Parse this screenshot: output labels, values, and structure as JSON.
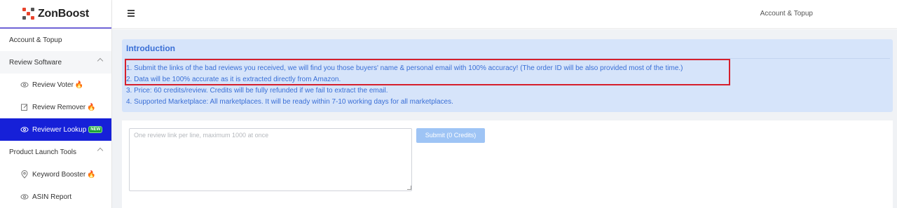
{
  "brand": {
    "name_prefix": "Zon",
    "name_suffix": "Boost",
    "logo_colors": [
      "#e8432c",
      "#555555"
    ]
  },
  "header": {
    "menu_icon": "hamburger-icon",
    "account_link": "Account & Topup"
  },
  "sidebar": {
    "items": [
      {
        "label": "Account & Topup",
        "type": "top"
      },
      {
        "label": "Review Software",
        "type": "group"
      },
      {
        "label": "Review Voter",
        "type": "sub",
        "icon": "eye-icon",
        "hot": true
      },
      {
        "label": "Review Remover",
        "type": "sub",
        "icon": "edit-icon",
        "hot": true
      },
      {
        "label": "Reviewer Lookup",
        "type": "sub",
        "icon": "eye-icon",
        "badge": "NEW",
        "active": true
      },
      {
        "label": "Product Launch Tools",
        "type": "group"
      },
      {
        "label": "Keyword Booster",
        "type": "sub",
        "icon": "location-pin-icon",
        "hot": true
      },
      {
        "label": "ASIN Report",
        "type": "sub",
        "icon": "eye-icon"
      }
    ]
  },
  "intro": {
    "title": "Introduction",
    "line1_main": "1. Submit the links of the bad reviews you received, we will find you those buyers' name & personal email with 100% accuracy!",
    "line1_note": " (The order ID will be also provided most of the time.)",
    "line2": "2. Data will be 100% accurate as it is extracted directly from Amazon.",
    "line3": "3. Price: 60 credits/review. Credits will be fully refunded if we fail to extract the email.",
    "line4": "4. Supported Marketplace: All marketplaces. It will be ready within 7-10 working days for all marketplaces."
  },
  "form": {
    "placeholder": "One review link per line, maximum 1000 at once",
    "submit_label": "Submit (0 Credits)"
  },
  "colors": {
    "accent": "#1620d8",
    "intro_bg": "#d6e4fa",
    "intro_text": "#3a6fd6",
    "highlight": "#d61f2c",
    "submit_bg": "#9ec4f5"
  }
}
